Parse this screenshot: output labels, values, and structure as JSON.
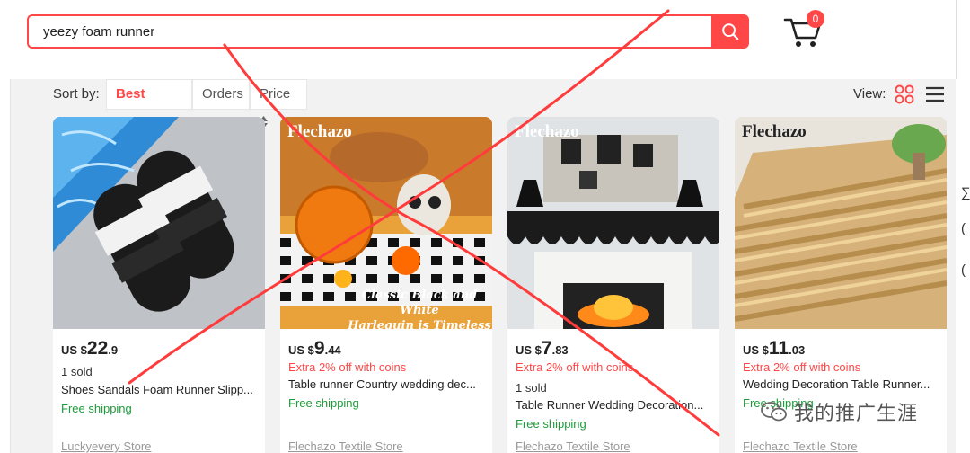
{
  "search": {
    "query": "yeezy foam runner"
  },
  "cart": {
    "count": "0"
  },
  "sort": {
    "label": "Sort by:",
    "options": [
      {
        "label": "Best Match"
      },
      {
        "label": "Orders"
      },
      {
        "label": "Price"
      }
    ]
  },
  "view": {
    "label": "View:"
  },
  "products": [
    {
      "watermark": "",
      "price_currency": "US $",
      "price_int": "22",
      "price_dec": ".9",
      "sold": "1 sold",
      "title": "Shoes Sandals Foam Runner Slipp...",
      "shipping": "Free shipping",
      "store": "Luckyevery Store"
    },
    {
      "watermark": "Flechazo",
      "price_currency": "US $",
      "price_int": "9",
      "price_dec": ".44",
      "promo": "Extra 2% off with coins",
      "title": "Table runner Country wedding dec...",
      "shipping": "Free shipping",
      "store": "Flechazo Textile Store",
      "banner_line1": "Classic Black and White",
      "banner_line2": "Harlequin is Timeless"
    },
    {
      "watermark": "Flechazo",
      "price_currency": "US $",
      "price_int": "7",
      "price_dec": ".83",
      "promo": "Extra 2% off with coins",
      "sold": "1 sold",
      "title": "Table Runner Wedding Decoration...",
      "shipping": "Free shipping",
      "store": "Flechazo Textile Store"
    },
    {
      "watermark": "Flechazo",
      "price_currency": "US $",
      "price_int": "11",
      "price_dec": ".03",
      "promo": "Extra 2% off with coins",
      "title": "Wedding Decoration Table Runner...",
      "shipping": "Free shipping",
      "store": "Flechazo Textile Store"
    }
  ],
  "watermark_overlay": {
    "text": "我的推广生涯"
  },
  "colors": {
    "accent": "#ff4747",
    "shipping": "#1d9c3a",
    "muted": "#999999"
  },
  "icons": {
    "search": "search-icon",
    "cart": "cart-icon",
    "grid_view": "grid-view-icon",
    "list_view": "list-view-icon",
    "sort_arrows": "sort-arrows-icon"
  }
}
